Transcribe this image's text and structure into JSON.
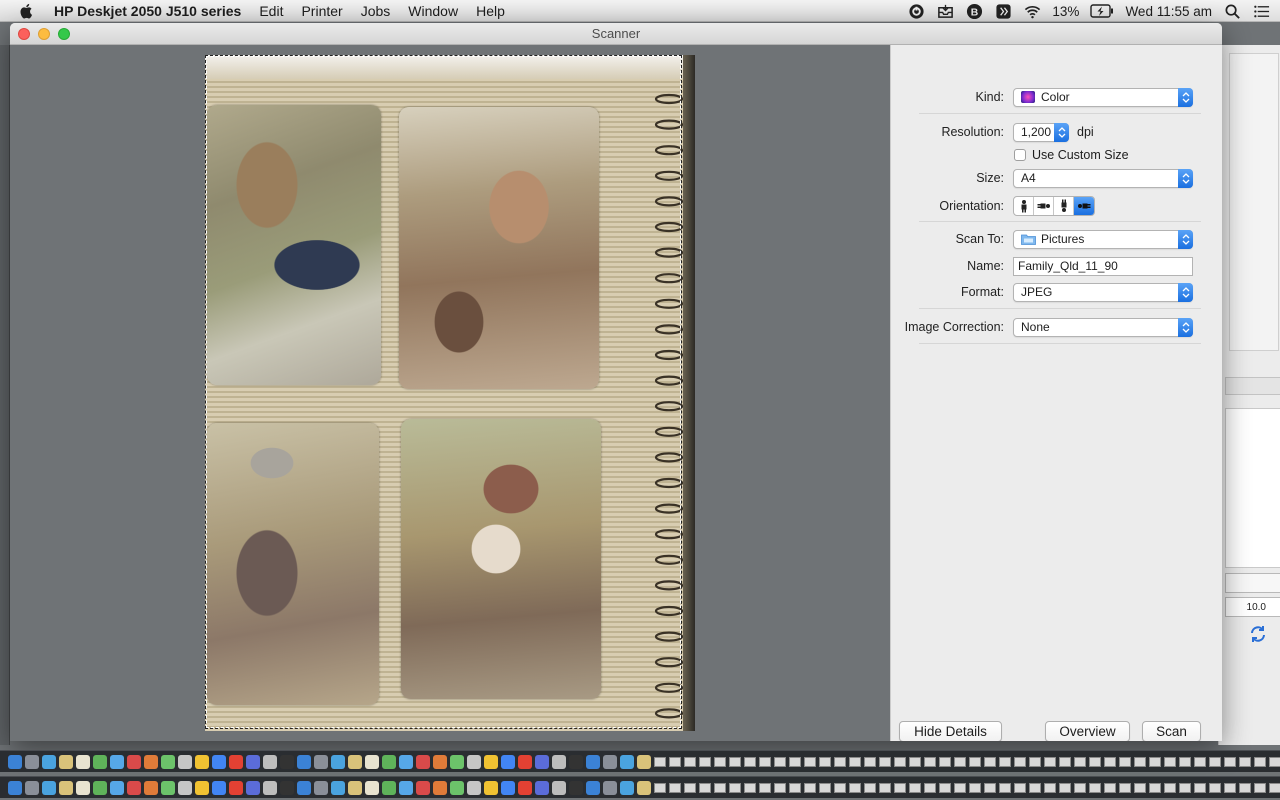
{
  "menubar": {
    "app_name": "HP Deskjet 2050 J510 series",
    "items": [
      "Edit",
      "Printer",
      "Jobs",
      "Window",
      "Help"
    ],
    "battery_percent": "13%",
    "clock": "Wed 11:55 am"
  },
  "window": {
    "title": "Scanner"
  },
  "background_window": {
    "stepper_value": "10.0"
  },
  "details": {
    "kind": {
      "label": "Kind:",
      "value": "Color"
    },
    "resolution": {
      "label": "Resolution:",
      "value": "1,200",
      "unit": "dpi"
    },
    "custom_size": {
      "label": "Use Custom Size",
      "checked": false
    },
    "size": {
      "label": "Size:",
      "value": "A4"
    },
    "orientation": {
      "label": "Orientation:",
      "selected_index": 3
    },
    "scan_to": {
      "label": "Scan To:",
      "value": "Pictures"
    },
    "name": {
      "label": "Name:",
      "value": "Family_Qld_11_90"
    },
    "format": {
      "label": "Format:",
      "value": "JPEG"
    },
    "image_correction": {
      "label": "Image Correction:",
      "value": "None"
    }
  },
  "buttons": {
    "hide_details": "Hide Details",
    "overview": "Overview",
    "scan": "Scan"
  },
  "colors": {
    "accent": "#1a6fe0",
    "close": "#fc605c",
    "minimize": "#fdbc40",
    "zoom": "#34c84a"
  }
}
